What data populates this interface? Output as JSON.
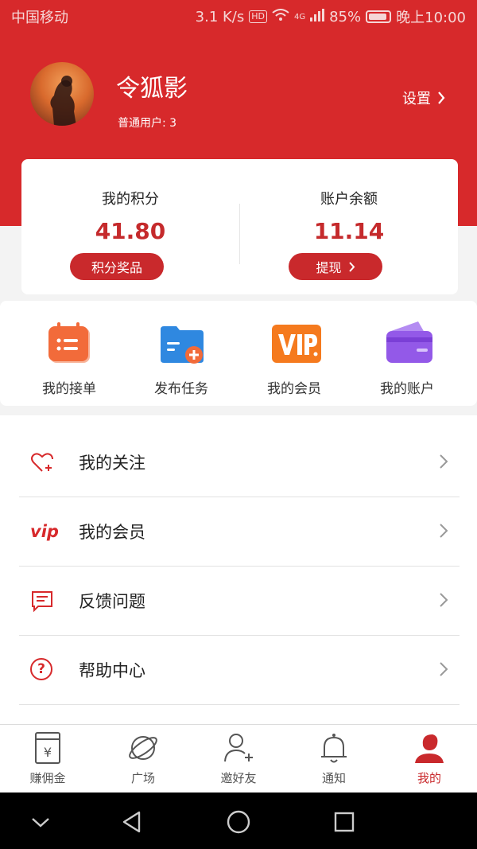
{
  "status": {
    "carrier": "中国移动",
    "speed": "3.1 K/s",
    "hd": "HD",
    "network": "4G",
    "battery": "85%",
    "time": "晚上10:00"
  },
  "profile": {
    "username": "令狐影",
    "level": "普通用户: 3",
    "settings_label": "设置"
  },
  "points_card": {
    "points_title": "我的积分",
    "points_value": "41.80",
    "points_button": "积分奖品",
    "balance_title": "账户余额",
    "balance_value": "11.14",
    "withdraw_button": "提现"
  },
  "quick_actions": [
    {
      "label": "我的接单",
      "icon": "calendar-list-icon"
    },
    {
      "label": "发布任务",
      "icon": "folder-add-icon"
    },
    {
      "label": "我的会员",
      "icon": "vip-badge-icon"
    },
    {
      "label": "我的账户",
      "icon": "wallet-card-icon"
    }
  ],
  "menu_items": [
    {
      "label": "我的关注",
      "icon": "heart-plus-icon"
    },
    {
      "label": "我的会员",
      "icon": "vip-text-icon",
      "icon_text": "vip"
    },
    {
      "label": "反馈问题",
      "icon": "feedback-icon"
    },
    {
      "label": "帮助中心",
      "icon": "help-circle-icon",
      "icon_text": "?"
    }
  ],
  "bottom_nav": [
    {
      "label": "赚佣金",
      "icon": "money-envelope-icon",
      "icon_text": "¥"
    },
    {
      "label": "广场",
      "icon": "planet-icon"
    },
    {
      "label": "邀好友",
      "icon": "add-friend-icon"
    },
    {
      "label": "通知",
      "icon": "bell-icon"
    },
    {
      "label": "我的",
      "icon": "profile-icon",
      "active": true
    }
  ],
  "colors": {
    "brand_red": "#d7292b",
    "button_red": "#c9292c",
    "value_red": "#c52a2c"
  }
}
